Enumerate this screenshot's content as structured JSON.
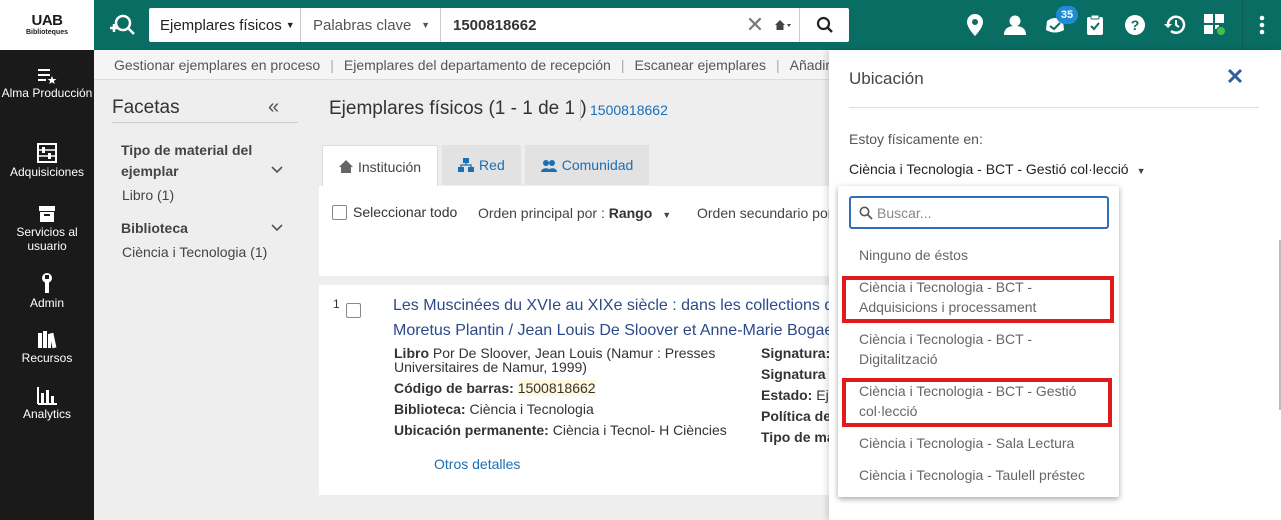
{
  "app": {
    "logo_main": "UAB",
    "logo_sub": "Biblioteques"
  },
  "search": {
    "scope": "Ejemplares físicos",
    "field": "Palabras clave",
    "query": "1500818662",
    "clear_icon": "close-icon",
    "home_icon": "home-icon",
    "go_icon": "search-icon"
  },
  "top_icons": {
    "location": "location-pin-icon",
    "user": "user-icon",
    "tasks": "tasks-icon",
    "tasks_count": "35",
    "clipboard": "clipboard-icon",
    "help": "help-icon",
    "history": "history-icon",
    "widgets": "widgets-icon",
    "menu": "more-vertical-icon"
  },
  "leftnav": [
    {
      "icon": "alma-icon",
      "label": "Alma Producción"
    },
    {
      "icon": "abacus-icon",
      "label": "Adquisiciones"
    },
    {
      "icon": "inbox-icon",
      "label": "Servicios al usuario"
    },
    {
      "icon": "wrench-icon",
      "label": "Admin"
    },
    {
      "icon": "books-icon",
      "label": "Recursos"
    },
    {
      "icon": "chart-icon",
      "label": "Analytics"
    }
  ],
  "subnav": [
    "Gestionar ejemplares en proceso",
    "Ejemplares del departamento de recepción",
    "Escanear ejemplares",
    "Añadir"
  ],
  "facets": {
    "title": "Facetas",
    "groups": [
      {
        "title": "Tipo de material del ejemplar",
        "values": [
          "Libro (1)"
        ]
      },
      {
        "title": "Biblioteca",
        "values": [
          "Ciència i Tecnologia (1)"
        ]
      }
    ]
  },
  "main": {
    "title": "Ejemplares físicos (1 - 1 de 1 )",
    "query": "1500818662",
    "tabs": [
      "Institución",
      "Red",
      "Comunidad"
    ],
    "select_all": "Seleccionar todo",
    "sort_primary_label": "Orden principal por :",
    "sort_primary_value": "Rango",
    "sort_secondary_label": "Orden secundario por"
  },
  "result": {
    "number": "1",
    "title_line1": "Les Muscinées du XVIe au XIXe siècle : dans les collections du",
    "title_line2": "Moretus Plantin / Jean Louis De Sloover et Anne-Marie Bogaert",
    "type": "Libro",
    "author_line1": "Por De Sloover, Jean Louis (Namur : Presses",
    "author_line2": "Universitaires de Namur, 1999)",
    "barcode_label": "Código de barras:",
    "barcode": "1500818662",
    "library_label": "Biblioteca:",
    "library": "Ciència i Tecnologia",
    "location_label": "Ubicación permanente:",
    "location": "Ciència i Tecnol- H Ciències",
    "right_labels": [
      "Signatura:",
      "Signatura a",
      "Estado:",
      "Política de",
      "Tipo de ma"
    ],
    "status_value": "Eje",
    "more_link": "Otros detalles"
  },
  "panel": {
    "title": "Ubicación",
    "label": "Estoy físicamente en:",
    "selected": "Ciència i Tecnologia - BCT - Gestió col·lecció",
    "search_placeholder": "Buscar...",
    "options": [
      "Ninguno de éstos",
      "Ciència i Tecnologia - BCT - Adquisicions i processament",
      "Ciència i Tecnologia - BCT - Digitalització",
      "Ciència i Tecnologia - BCT - Gestió col·lecció",
      "Ciència i Tecnologia - Sala Lectura",
      "Ciència i Tecnologia - Taulell préstec"
    ]
  },
  "colors": {
    "topbar": "#0a6d63",
    "leftnav": "#1a1a1a",
    "link": "#1b6fb3",
    "highlight": "#e01b1b",
    "badge": "#1f8bd6"
  }
}
